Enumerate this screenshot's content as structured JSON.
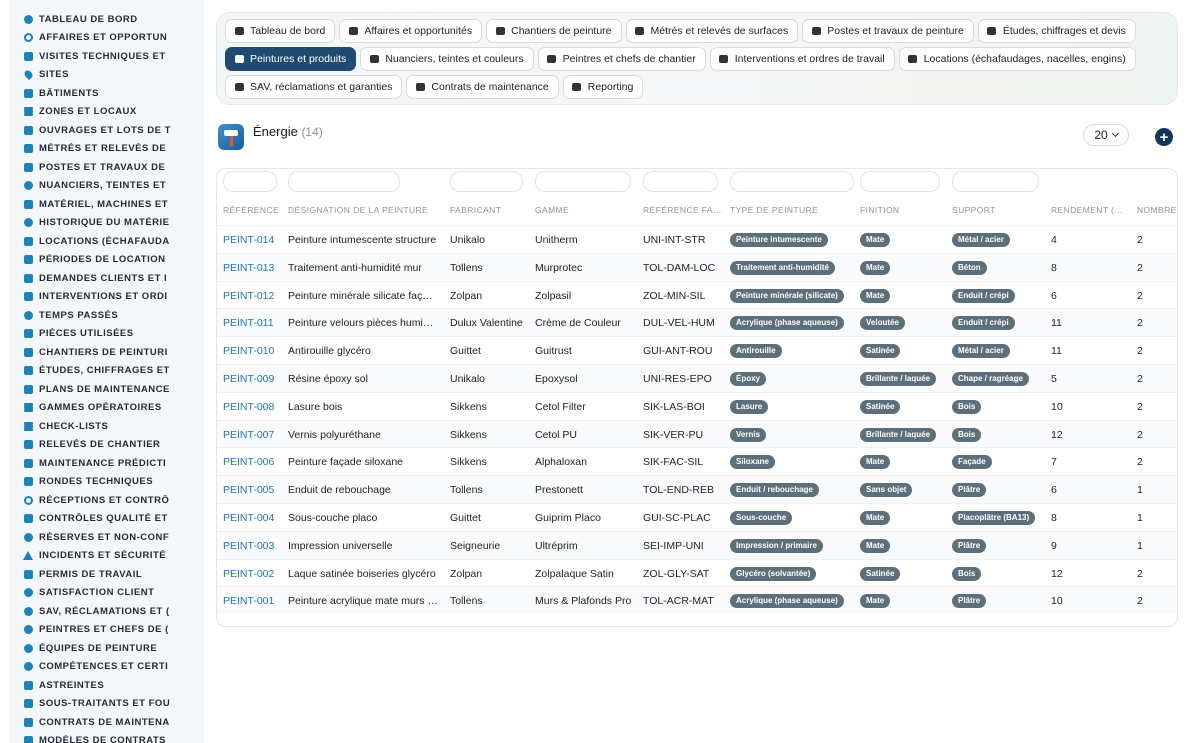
{
  "sidebar": {
    "items": [
      {
        "label": "TABLEAU DE BORD",
        "icon": "dashboard-icon"
      },
      {
        "label": "AFFAIRES ET OPPORTUN",
        "icon": "target-icon"
      },
      {
        "label": "VISITES TECHNIQUES ET",
        "icon": "list-icon"
      },
      {
        "label": "SITES",
        "icon": "pin-icon"
      },
      {
        "label": "BÂTIMENTS",
        "icon": "building-icon"
      },
      {
        "label": "ZONES ET LOCAUX",
        "icon": "door-icon"
      },
      {
        "label": "OUVRAGES ET LOTS DE T",
        "icon": "sitemap-icon"
      },
      {
        "label": "MÉTRÉS ET RELEVÉS DE",
        "icon": "ruler-icon"
      },
      {
        "label": "POSTES ET TRAVAUX DE",
        "icon": "roller-icon"
      },
      {
        "label": "NUANCIERS, TEINTES ET",
        "icon": "palette-icon"
      },
      {
        "label": "MATÉRIEL, MACHINES ET",
        "icon": "gears-icon"
      },
      {
        "label": "HISTORIQUE DU MATÉRIE",
        "icon": "history-icon"
      },
      {
        "label": "LOCATIONS (ÉCHAFAUDA",
        "icon": "truck-icon"
      },
      {
        "label": "PÉRIODES DE LOCATION",
        "icon": "calendar-icon"
      },
      {
        "label": "DEMANDES CLIENTS ET I",
        "icon": "file-icon"
      },
      {
        "label": "INTERVENTIONS ET ORDI",
        "icon": "clipboard-icon"
      },
      {
        "label": "TEMPS PASSÉS",
        "icon": "clock-icon"
      },
      {
        "label": "PIÈCES UTILISÉES",
        "icon": "puzzle-icon"
      },
      {
        "label": "CHANTIERS DE PEINTURI",
        "icon": "hammer-icon"
      },
      {
        "label": "ÉTUDES, CHIFFRAGES ET",
        "icon": "calculator-icon"
      },
      {
        "label": "PLANS DE MAINTENANCE",
        "icon": "calendar-check-icon"
      },
      {
        "label": "GAMMES OPÉRATOIRES",
        "icon": "layers-icon"
      },
      {
        "label": "CHECK-LISTS",
        "icon": "checklist-icon"
      },
      {
        "label": "RELEVÉS DE CHANTIER",
        "icon": "thermometer-icon"
      },
      {
        "label": "MAINTENANCE PRÉDICTI",
        "icon": "chart-icon"
      },
      {
        "label": "RONDES TECHNIQUES",
        "icon": "route-icon"
      },
      {
        "label": "RÉCEPTIONS ET CONTRÔ",
        "icon": "search-icon"
      },
      {
        "label": "CONTRÔLES QUALITÉ ET",
        "icon": "clipboard-check-icon"
      },
      {
        "label": "RÉSERVES ET NON-CONF",
        "icon": "alert-circle-icon"
      },
      {
        "label": "INCIDENTS ET SÉCURITÉ",
        "icon": "warning-icon"
      },
      {
        "label": "PERMIS DE TRAVAIL",
        "icon": "file-signature-icon"
      },
      {
        "label": "SATISFACTION CLIENT",
        "icon": "smile-icon"
      },
      {
        "label": "SAV, RÉCLAMATIONS ET (",
        "icon": "chat-icon"
      },
      {
        "label": "PEINTRES ET CHEFS DE (",
        "icon": "comment-icon"
      },
      {
        "label": "ÉQUIPES DE PEINTURE",
        "icon": "users-icon"
      },
      {
        "label": "COMPÉTENCES ET CERTI",
        "icon": "certificate-icon"
      },
      {
        "label": "ASTREINTES",
        "icon": "phone-icon"
      },
      {
        "label": "SOUS-TRAITANTS ET FOU",
        "icon": "handshake-icon"
      },
      {
        "label": "CONTRATS DE MAINTENA",
        "icon": "contract-icon"
      },
      {
        "label": "MODÈLES DE CONTRATS",
        "icon": "template-icon"
      }
    ]
  },
  "tabs": {
    "rows": [
      [
        {
          "label": "Tableau de bord",
          "icon": "dashboard-icon",
          "active": false
        },
        {
          "label": "Affaires et opportunités",
          "icon": "target-icon",
          "active": false
        },
        {
          "label": "Chantiers de peinture",
          "icon": "hammer-icon",
          "active": false
        },
        {
          "label": "Métrés et relevés de surfaces",
          "icon": "ruler-icon",
          "active": false
        },
        {
          "label": "Postes et travaux de peinture",
          "icon": "roller-icon",
          "active": false
        },
        {
          "label": "Études, chiffrages et devis",
          "icon": "calculator-icon",
          "active": false
        }
      ],
      [
        {
          "label": "Peintures et produits",
          "icon": "spray-icon",
          "active": true
        },
        {
          "label": "Nuanciers, teintes et couleurs",
          "icon": "palette-icon",
          "active": false
        },
        {
          "label": "Peintres et chefs de chantier",
          "icon": "helmet-icon",
          "active": false
        },
        {
          "label": "Interventions et ordres de travail",
          "icon": "clipboard-icon",
          "active": false
        },
        {
          "label": "Locations (échafaudages, nacelles, engins)",
          "icon": "truck-icon",
          "active": false
        }
      ],
      [
        {
          "label": "SAV, réclamations et garanties",
          "icon": "chat-icon",
          "active": false
        },
        {
          "label": "Contrats de maintenance",
          "icon": "contract-icon",
          "active": false
        },
        {
          "label": "Reporting",
          "icon": "chart-pie-icon",
          "active": false
        }
      ]
    ]
  },
  "section": {
    "title": "Énergie",
    "count": "(14)",
    "icon": "paint-roller-icon",
    "per_page": "20"
  },
  "table": {
    "columns": [
      "RÉFÉRENCE",
      "DÉSIGNATION DE LA PEINTURE",
      "FABRICANT",
      "GAMME",
      "RÉFÉRENCE FA…",
      "TYPE DE PEINTURE",
      "FINITION",
      "SUPPORT",
      "RENDEMENT (…",
      "NOMBRE"
    ],
    "rows": [
      [
        "PEINT-014",
        "Peinture intumescente structure",
        "Unikalo",
        "Unitherm",
        "UNI-INT-STR",
        "Peinture intumescente",
        "Mate",
        "Métal / acier",
        "4",
        "2"
      ],
      [
        "PEINT-013",
        "Traitement anti-humidité mur",
        "Tollens",
        "Murprotec",
        "TOL-DAM-LOC",
        "Traitement anti-humidité",
        "Mate",
        "Béton",
        "8",
        "2"
      ],
      [
        "PEINT-012",
        "Peinture minérale silicate faç…",
        "Zolpan",
        "Zolpasil",
        "ZOL-MIN-SIL",
        "Peinture minérale (silicate)",
        "Mate",
        "Enduit / crépi",
        "6",
        "2"
      ],
      [
        "PEINT-011",
        "Peinture velours pièces humi…",
        "Dulux Valentine",
        "Crème de Couleur",
        "DUL-VEL-HUM",
        "Acrylique (phase aqueuse)",
        "Veloutée",
        "Enduit / crépi",
        "11",
        "2"
      ],
      [
        "PEINT-010",
        "Antirouille glycéro",
        "Guittet",
        "Guitrust",
        "GUI-ANT-ROU",
        "Antirouille",
        "Satinée",
        "Métal / acier",
        "11",
        "2"
      ],
      [
        "PEINT-009",
        "Résine époxy sol",
        "Unikalo",
        "Epoxysol",
        "UNI-RES-EPO",
        "Époxy",
        "Brillante / laquée",
        "Chape / ragréage",
        "5",
        "2"
      ],
      [
        "PEINT-008",
        "Lasure bois",
        "Sikkens",
        "Cetol Filter",
        "SIK-LAS-BOI",
        "Lasure",
        "Satinée",
        "Bois",
        "10",
        "2"
      ],
      [
        "PEINT-007",
        "Vernis polyuréthane",
        "Sikkens",
        "Cetol PU",
        "SIK-VER-PU",
        "Vernis",
        "Brillante / laquée",
        "Bois",
        "12",
        "2"
      ],
      [
        "PEINT-006",
        "Peinture façade siloxane",
        "Sikkens",
        "Alphaloxan",
        "SIK-FAC-SIL",
        "Siloxane",
        "Mate",
        "Façade",
        "7",
        "2"
      ],
      [
        "PEINT-005",
        "Enduit de rebouchage",
        "Tollens",
        "Prestonett",
        "TOL-END-REB",
        "Enduit / rebouchage",
        "Sans objet",
        "Plâtre",
        "6",
        "1"
      ],
      [
        "PEINT-004",
        "Sous-couche placo",
        "Guittet",
        "Guiprim Placo",
        "GUI-SC-PLAC",
        "Sous-couche",
        "Mate",
        "Placoplâtre (BA13)",
        "8",
        "1"
      ],
      [
        "PEINT-003",
        "Impression universelle",
        "Seigneurie",
        "Ultréprim",
        "SEI-IMP-UNI",
        "Impression / primaire",
        "Mate",
        "Plâtre",
        "9",
        "1"
      ],
      [
        "PEINT-002",
        "Laque satinée boiseries glycéro",
        "Zolpan",
        "Zolpalaque Satin",
        "ZOL-GLY-SAT",
        "Glycéro (solvantée)",
        "Satinée",
        "Bois",
        "12",
        "2"
      ],
      [
        "PEINT-001",
        "Peinture acrylique mate murs …",
        "Tollens",
        "Murs & Plafonds Pro",
        "TOL-ACR-MAT",
        "Acrylique (phase aqueuse)",
        "Mate",
        "Plâtre",
        "10",
        "2"
      ]
    ]
  },
  "colors": {
    "accent": "#1f4a72",
    "link": "#1f74c2",
    "badge": "#5d6f7b",
    "sidebar_icon": "#1d82b8"
  }
}
